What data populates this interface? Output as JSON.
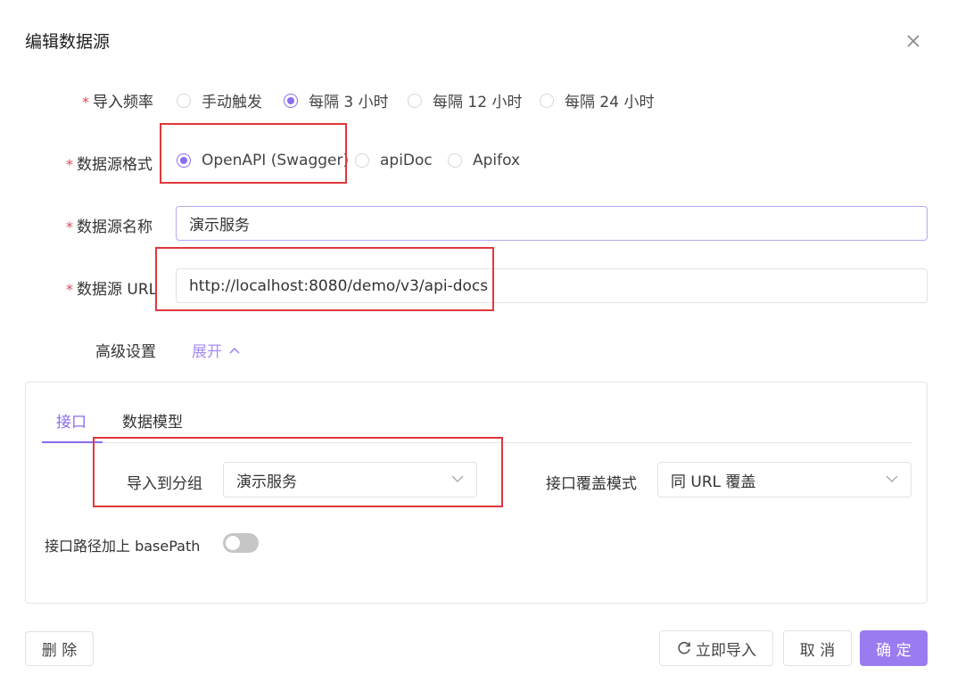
{
  "dialog": {
    "title": "编辑数据源",
    "close_icon": "close-icon"
  },
  "form": {
    "frequency": {
      "label": "导入频率",
      "required_mark": "*",
      "options": [
        {
          "label": "手动触发",
          "checked": false
        },
        {
          "label": "每隔 3 小时",
          "checked": true
        },
        {
          "label": "每隔 12 小时",
          "checked": false
        },
        {
          "label": "每隔 24 小时",
          "checked": false
        }
      ]
    },
    "format": {
      "label": "数据源格式",
      "required_mark": "*",
      "options": [
        {
          "label": "OpenAPI (Swagger)",
          "checked": true
        },
        {
          "label": "apiDoc",
          "checked": false
        },
        {
          "label": "Apifox",
          "checked": false
        }
      ]
    },
    "name": {
      "label": "数据源名称",
      "required_mark": "*",
      "value": "演示服务"
    },
    "url": {
      "label": "数据源 URL",
      "required_mark": "*",
      "value": "http://localhost:8080/demo/v3/api-docs"
    },
    "advanced": {
      "label": "高级设置",
      "toggle_label": "展开",
      "toggle_icon": "chevron-up-icon"
    }
  },
  "panel": {
    "tabs": [
      {
        "label": "接口",
        "active": true
      },
      {
        "label": "数据模型",
        "active": false
      }
    ],
    "import_group": {
      "label": "导入到分组",
      "value": "演示服务"
    },
    "override_mode": {
      "label": "接口覆盖模式",
      "value": "同 URL 覆盖"
    },
    "base_path": {
      "label": "接口路径加上 basePath",
      "enabled": false
    }
  },
  "footer": {
    "delete_label": "删 除",
    "import_now_label": "立即导入",
    "import_now_icon": "refresh-icon",
    "cancel_label": "取 消",
    "confirm_label": "确 定"
  },
  "colors": {
    "accent": "#8a6cf0",
    "primary_button": "#9b7bf0",
    "required": "#e04a5b",
    "annotation_box": "#e0383b"
  }
}
